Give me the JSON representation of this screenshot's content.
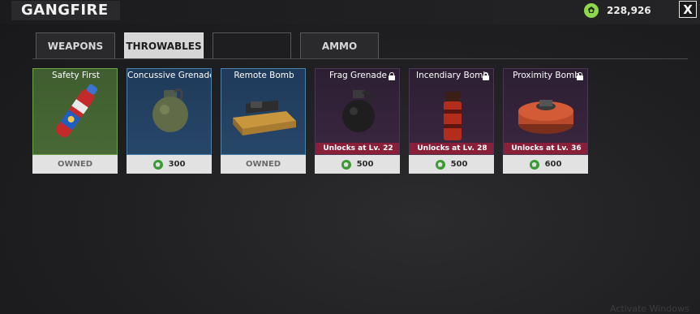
{
  "header": {
    "title": "GANGFIRE",
    "currency_value": "228,926",
    "close_label": "X"
  },
  "tabs": [
    {
      "label": "WEAPONS",
      "active": false
    },
    {
      "label": "THROWABLES",
      "active": true
    },
    {
      "label": "",
      "active": false
    },
    {
      "label": "AMMO",
      "active": false
    }
  ],
  "items": [
    {
      "name": "Safety First",
      "rarity": "green",
      "footer": "OWNED",
      "owned": true,
      "locked": false,
      "unlock": "",
      "icon": "spray-can-icon"
    },
    {
      "name": "Concussive Grenade",
      "rarity": "blue",
      "footer": "300",
      "owned": false,
      "locked": false,
      "unlock": "",
      "icon": "concussive-grenade-icon"
    },
    {
      "name": "Remote Bomb",
      "rarity": "blue",
      "footer": "OWNED",
      "owned": true,
      "locked": false,
      "unlock": "",
      "icon": "remote-bomb-icon"
    },
    {
      "name": "Frag Grenade",
      "rarity": "locked",
      "footer": "500",
      "owned": false,
      "locked": true,
      "unlock": "Unlocks at Lv. 22",
      "icon": "frag-grenade-icon"
    },
    {
      "name": "Incendiary Bomb",
      "rarity": "locked",
      "footer": "500",
      "owned": false,
      "locked": true,
      "unlock": "Unlocks at Lv. 28",
      "icon": "incendiary-bomb-icon"
    },
    {
      "name": "Proximity Bomb",
      "rarity": "locked",
      "footer": "600",
      "owned": false,
      "locked": true,
      "unlock": "Unlocks at Lv. 36",
      "icon": "proximity-bomb-icon"
    }
  ],
  "watermark": "Activate Windows",
  "colors": {
    "accent_gem": "#8fd84b",
    "unlock_bar": "#8a1f3a",
    "rarity_green": "#486936",
    "rarity_blue": "#274769",
    "rarity_locked": "#3a2640"
  }
}
